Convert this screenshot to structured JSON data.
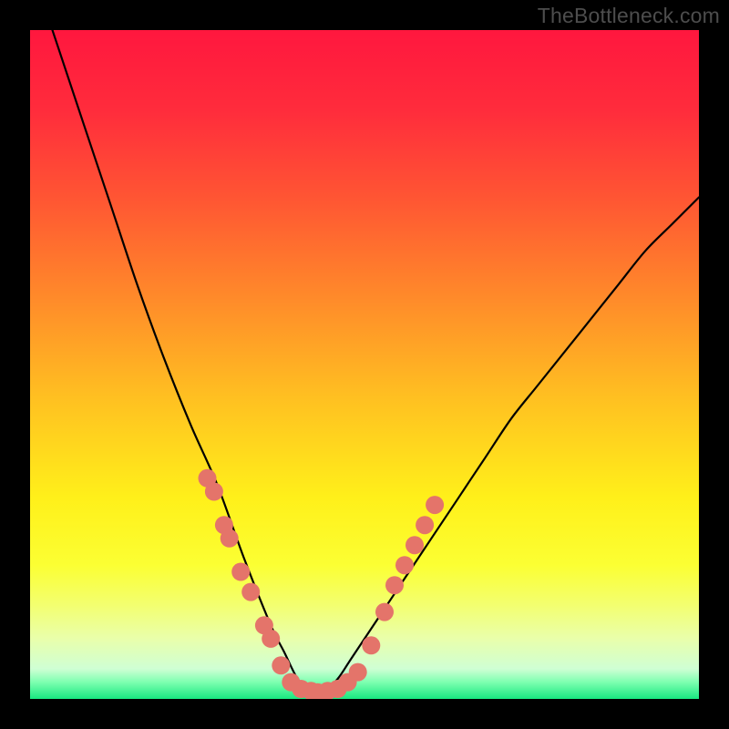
{
  "watermark": "TheBottleneck.com",
  "chart_data": {
    "type": "line",
    "title": "",
    "xlabel": "",
    "ylabel": "",
    "xlim": [
      0,
      100
    ],
    "ylim": [
      0,
      100
    ],
    "grid": false,
    "legend": false,
    "comment": "V-shaped bottleneck curve over rainbow gradient background; y is a mismatch/penalty percentage with minimum ~0 near x≈43. Green band near bottom indicates optimal zone. Salmon dots mark sampled configurations.",
    "curve": {
      "name": "bottleneck-curve",
      "x": [
        0,
        4,
        8,
        12,
        16,
        20,
        24,
        28,
        32,
        36,
        38,
        40,
        42,
        43,
        44,
        46,
        48,
        52,
        56,
        60,
        64,
        68,
        72,
        76,
        80,
        84,
        88,
        92,
        96,
        100
      ],
      "y": [
        110,
        98,
        86,
        74,
        62,
        51,
        41,
        32,
        21,
        11,
        7,
        3,
        1,
        0,
        1,
        3,
        6,
        12,
        18,
        24,
        30,
        36,
        42,
        47,
        52,
        57,
        62,
        67,
        71,
        75
      ]
    },
    "scatter": {
      "name": "sampled-points",
      "color": "#e4746a",
      "points": [
        {
          "x": 26.5,
          "y": 33
        },
        {
          "x": 27.5,
          "y": 31
        },
        {
          "x": 29.0,
          "y": 26
        },
        {
          "x": 29.8,
          "y": 24
        },
        {
          "x": 31.5,
          "y": 19
        },
        {
          "x": 33.0,
          "y": 16
        },
        {
          "x": 35.0,
          "y": 11
        },
        {
          "x": 36.0,
          "y": 9
        },
        {
          "x": 37.5,
          "y": 5
        },
        {
          "x": 39.0,
          "y": 2.5
        },
        {
          "x": 40.5,
          "y": 1.5
        },
        {
          "x": 42.0,
          "y": 1.2
        },
        {
          "x": 43.0,
          "y": 1.0
        },
        {
          "x": 44.5,
          "y": 1.2
        },
        {
          "x": 46.0,
          "y": 1.5
        },
        {
          "x": 47.5,
          "y": 2.5
        },
        {
          "x": 49.0,
          "y": 4
        },
        {
          "x": 51.0,
          "y": 8
        },
        {
          "x": 53.0,
          "y": 13
        },
        {
          "x": 54.5,
          "y": 17
        },
        {
          "x": 56.0,
          "y": 20
        },
        {
          "x": 57.5,
          "y": 23
        },
        {
          "x": 59.0,
          "y": 26
        },
        {
          "x": 60.5,
          "y": 29
        }
      ]
    },
    "gradient_stops": [
      {
        "offset": 0.0,
        "color": "#ff173e"
      },
      {
        "offset": 0.12,
        "color": "#ff2c3c"
      },
      {
        "offset": 0.25,
        "color": "#ff5533"
      },
      {
        "offset": 0.4,
        "color": "#ff8a2a"
      },
      {
        "offset": 0.55,
        "color": "#ffc021"
      },
      {
        "offset": 0.7,
        "color": "#fff01a"
      },
      {
        "offset": 0.8,
        "color": "#fbff33"
      },
      {
        "offset": 0.86,
        "color": "#f3ff70"
      },
      {
        "offset": 0.91,
        "color": "#e9ffab"
      },
      {
        "offset": 0.955,
        "color": "#cfffd4"
      },
      {
        "offset": 0.975,
        "color": "#7dffb0"
      },
      {
        "offset": 1.0,
        "color": "#18e880"
      }
    ]
  }
}
